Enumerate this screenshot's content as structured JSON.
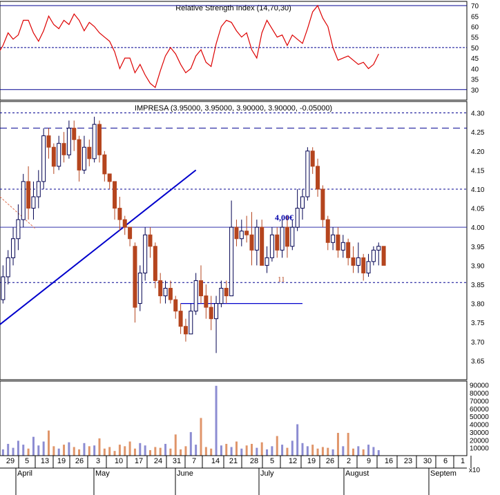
{
  "rsi_panel": {
    "title": "Relative Strength Index (14,70,30)",
    "ylim": [
      25,
      72
    ],
    "ticks": [
      30,
      35,
      40,
      45,
      50,
      55,
      60,
      65,
      70
    ],
    "levels": [
      30,
      50,
      70
    ]
  },
  "price_panel": {
    "title": "IMPRESA (3.95000, 3.95000, 3.90000, 3.90000, -0.05000)",
    "ylim": [
      3.6,
      4.33
    ],
    "ticks": [
      3.65,
      3.7,
      3.75,
      3.8,
      3.85,
      3.9,
      3.95,
      4.0,
      4.05,
      4.1,
      4.15,
      4.2,
      4.25,
      4.3
    ],
    "annotation": "4,00€",
    "marker_text": "11"
  },
  "volume_panel": {
    "ylim": [
      0,
      95000
    ],
    "ticks": [
      10000,
      20000,
      30000,
      40000,
      50000,
      60000,
      70000,
      80000,
      90000
    ],
    "scale_label": "x10"
  },
  "x_axis": {
    "day_labels": [
      "29",
      "5",
      "13",
      "19",
      "26",
      "3",
      "10",
      "17",
      "24",
      "31",
      "7",
      "14",
      "21",
      "28",
      "5",
      "12",
      "19",
      "26",
      "2",
      "9",
      "16",
      "23",
      "30",
      "6",
      "1"
    ],
    "month_labels": [
      "April",
      "May",
      "June",
      "July",
      "August",
      "Septem"
    ]
  },
  "colors": {
    "up": "#ffffff",
    "down": "#b5451e",
    "outline": "#000050",
    "rsi_line": "#dd0000",
    "trendline": "#0000cc",
    "volume_down": "#e0956a",
    "volume_up": "#8c8cd2",
    "dashed": "#000090"
  },
  "chart_data": {
    "type": "candlestick",
    "x_start_index": -16,
    "candles": [
      [
        3.84,
        3.86,
        3.79,
        3.81
      ],
      [
        3.81,
        3.9,
        3.8,
        3.87
      ],
      [
        3.87,
        3.94,
        3.85,
        3.92
      ],
      [
        3.92,
        4.0,
        3.9,
        3.97
      ],
      [
        3.97,
        4.06,
        3.94,
        4.02
      ],
      [
        4.02,
        4.14,
        4.0,
        4.12
      ],
      [
        4.12,
        4.16,
        4.02,
        4.05
      ],
      [
        4.05,
        4.12,
        4.02,
        4.08
      ],
      [
        4.08,
        4.15,
        4.05,
        4.12
      ],
      [
        4.12,
        4.26,
        4.1,
        4.24
      ],
      [
        4.24,
        4.26,
        4.18,
        4.21
      ],
      [
        4.21,
        4.22,
        4.14,
        4.16
      ],
      [
        4.16,
        4.24,
        4.15,
        4.22
      ],
      [
        4.22,
        4.25,
        4.17,
        4.19
      ],
      [
        4.19,
        4.28,
        4.18,
        4.26
      ],
      [
        4.26,
        4.28,
        4.2,
        4.23
      ],
      [
        4.23,
        4.24,
        4.12,
        4.15
      ],
      [
        4.15,
        4.24,
        4.14,
        4.21
      ],
      [
        4.21,
        4.23,
        4.16,
        4.18
      ],
      [
        4.18,
        4.29,
        4.17,
        4.27
      ],
      [
        4.27,
        4.28,
        4.17,
        4.19
      ],
      [
        4.19,
        4.2,
        4.12,
        4.14
      ],
      [
        4.14,
        4.14,
        4.1,
        4.12
      ],
      [
        4.12,
        4.12,
        4.02,
        4.05
      ],
      [
        4.05,
        4.08,
        3.99,
        4.02
      ],
      [
        4.02,
        4.03,
        3.98,
        4.0
      ],
      [
        4.0,
        4.0,
        3.95,
        3.97
      ],
      [
        3.95,
        3.96,
        3.75,
        3.79
      ],
      [
        3.8,
        3.9,
        3.78,
        3.88
      ],
      [
        3.88,
        4.0,
        3.86,
        3.98
      ],
      [
        3.98,
        4.0,
        3.92,
        3.95
      ],
      [
        3.95,
        3.96,
        3.84,
        3.86
      ],
      [
        3.86,
        3.88,
        3.8,
        3.82
      ],
      [
        3.82,
        3.86,
        3.8,
        3.84
      ],
      [
        3.84,
        3.86,
        3.8,
        3.81
      ],
      [
        3.81,
        3.82,
        3.76,
        3.78
      ],
      [
        3.78,
        3.8,
        3.72,
        3.74
      ],
      [
        3.74,
        3.76,
        3.7,
        3.72
      ],
      [
        3.72,
        3.8,
        3.72,
        3.78
      ],
      [
        3.78,
        3.88,
        3.77,
        3.86
      ],
      [
        3.86,
        3.9,
        3.8,
        3.82
      ],
      [
        3.82,
        3.85,
        3.76,
        3.79
      ],
      [
        3.79,
        3.82,
        3.73,
        3.76
      ],
      [
        3.76,
        3.82,
        3.67,
        3.8
      ],
      [
        3.8,
        3.86,
        3.79,
        3.84
      ],
      [
        3.84,
        3.86,
        3.8,
        3.82
      ],
      [
        3.82,
        4.07,
        3.82,
        4.0
      ],
      [
        4.0,
        4.02,
        3.95,
        3.97
      ],
      [
        3.97,
        4.02,
        3.95,
        3.99
      ],
      [
        3.99,
        4.03,
        3.96,
        3.98
      ],
      [
        3.98,
        4.04,
        3.9,
        3.94
      ],
      [
        3.94,
        4.02,
        3.9,
        4.0
      ],
      [
        4.0,
        4.02,
        3.92,
        3.9
      ],
      [
        3.9,
        3.95,
        3.88,
        3.92
      ],
      [
        3.92,
        4.0,
        3.91,
        3.98
      ],
      [
        3.98,
        4.0,
        3.92,
        3.94
      ],
      [
        3.94,
        4.02,
        3.92,
        4.0
      ],
      [
        4.0,
        4.03,
        3.92,
        3.95
      ],
      [
        3.95,
        4.02,
        3.94,
        4.0
      ],
      [
        4.0,
        4.1,
        3.99,
        4.05
      ],
      [
        4.05,
        4.1,
        4.02,
        4.08
      ],
      [
        4.08,
        4.21,
        4.07,
        4.2
      ],
      [
        4.2,
        4.21,
        4.14,
        4.16
      ],
      [
        4.16,
        4.18,
        4.08,
        4.1
      ],
      [
        4.1,
        4.11,
        4.0,
        4.02
      ],
      [
        4.02,
        4.03,
        3.94,
        3.96
      ],
      [
        3.96,
        4.0,
        3.94,
        3.98
      ],
      [
        3.98,
        4.0,
        3.92,
        3.94
      ],
      [
        3.94,
        3.98,
        3.92,
        3.96
      ],
      [
        3.96,
        3.97,
        3.9,
        3.92
      ],
      [
        3.92,
        3.95,
        3.88,
        3.9
      ],
      [
        3.9,
        3.96,
        3.88,
        3.92
      ],
      [
        3.92,
        3.93,
        3.86,
        3.88
      ],
      [
        3.88,
        3.93,
        3.87,
        3.91
      ],
      [
        3.91,
        3.95,
        3.9,
        3.94
      ],
      [
        3.94,
        3.96,
        3.9,
        3.95
      ],
      [
        3.95,
        3.95,
        3.9,
        3.9
      ]
    ],
    "rsi": [
      47,
      51,
      57,
      54,
      56,
      63,
      63,
      57,
      53,
      58,
      65,
      61,
      59,
      63,
      61,
      66,
      63,
      58,
      62,
      60,
      57,
      55,
      53,
      48,
      40,
      45,
      45,
      38,
      42,
      37,
      33,
      31,
      39,
      46,
      50,
      47,
      42,
      38,
      40,
      46,
      49,
      43,
      41,
      52,
      60,
      63,
      62,
      58,
      55,
      57,
      49,
      45,
      57,
      63,
      59,
      55,
      56,
      51,
      56,
      54,
      52,
      59,
      67,
      70,
      64,
      60,
      50,
      44,
      45,
      46,
      44,
      42,
      43,
      40,
      42,
      47
    ],
    "volumes": [
      12000,
      8000,
      15000,
      10000,
      19000,
      14000,
      9000,
      24000,
      13000,
      18000,
      32000,
      12000,
      9000,
      14000,
      17000,
      11000,
      8000,
      16000,
      12000,
      13000,
      22000,
      9000,
      11000,
      6000,
      14000,
      12000,
      18000,
      9000,
      16000,
      13000,
      7000,
      11000,
      10000,
      15000,
      9000,
      27000,
      8000,
      12000,
      30000,
      14000,
      48000,
      11000,
      9000,
      89000,
      13000,
      15000,
      11000,
      18000,
      9000,
      13000,
      15000,
      10000,
      17000,
      8000,
      12000,
      25000,
      14000,
      10000,
      19000,
      40000,
      16000,
      12000,
      14000,
      9000,
      11000,
      10000,
      8000,
      29000,
      12000,
      29000,
      9000,
      12000,
      8000,
      14000,
      11000,
      7000
    ]
  }
}
